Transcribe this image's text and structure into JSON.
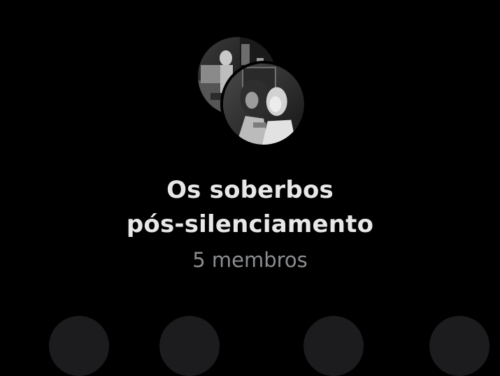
{
  "group": {
    "title_line1": "Os soberbos",
    "title_line2": "pós-silenciamento",
    "member_count": "5 membros"
  },
  "theme": {
    "background": "#000000",
    "title_color": "#e7e7e7",
    "subtitle_color": "#8b8d91",
    "button_bg": "#1c1c1e"
  },
  "avatars": [
    {
      "icon": "member-photo-avatar",
      "style": "black-and-white photo"
    },
    {
      "icon": "member-photo-avatar",
      "style": "black-and-white photo"
    }
  ],
  "actions": [
    {
      "icon": "action-button"
    },
    {
      "icon": "action-button"
    },
    {
      "icon": "action-button"
    },
    {
      "icon": "action-button"
    }
  ]
}
